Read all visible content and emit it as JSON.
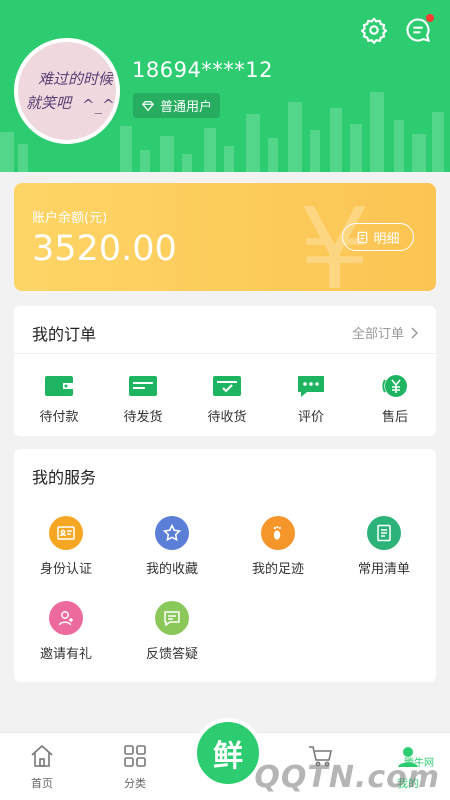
{
  "header": {
    "phone": "18694****12",
    "badge_label": "普通用户",
    "avatar_lines": [
      "难过的时候",
      "就笑吧",
      "^_^"
    ],
    "icons": [
      "gear-icon",
      "message-icon"
    ]
  },
  "balance": {
    "label": "账户余额(元)",
    "amount": "3520.00",
    "detail_label": "明细"
  },
  "orders": {
    "title": "我的订单",
    "all_label": "全部订单",
    "items": [
      {
        "label": "待付款",
        "icon": "wallet-icon"
      },
      {
        "label": "待发货",
        "icon": "truck-icon"
      },
      {
        "label": "待收货",
        "icon": "box-check-icon"
      },
      {
        "label": "评价",
        "icon": "chat-bubble-icon"
      },
      {
        "label": "售后",
        "icon": "yen-refund-icon"
      }
    ]
  },
  "services": {
    "title": "我的服务",
    "items": [
      {
        "label": "身份认证",
        "icon": "id-card-icon",
        "color": "#f5a623"
      },
      {
        "label": "我的收藏",
        "icon": "star-icon",
        "color": "#5b7fd6"
      },
      {
        "label": "我的足迹",
        "icon": "footprint-icon",
        "color": "#f5962a"
      },
      {
        "label": "常用清单",
        "icon": "list-icon",
        "color": "#2db37a"
      },
      {
        "label": "邀请有礼",
        "icon": "invite-user-icon",
        "color": "#ec6a9c"
      },
      {
        "label": "反馈答疑",
        "icon": "feedback-icon",
        "color": "#8ac85a"
      }
    ]
  },
  "nav": {
    "items": [
      {
        "label": "首页",
        "icon": "home-icon"
      },
      {
        "label": "分类",
        "icon": "grid-icon"
      },
      {
        "label": "",
        "icon": "fresh-logo-icon"
      },
      {
        "label": "",
        "icon": "cart-icon"
      },
      {
        "label": "我的",
        "icon": "user-icon"
      }
    ],
    "center_glyph": "鲜"
  },
  "watermark": {
    "text": "QQTN.com",
    "small": "腾牛网"
  },
  "colors": {
    "primary": "#2ecc71",
    "balance_start": "#fdd566",
    "balance_end": "#fcc453"
  }
}
